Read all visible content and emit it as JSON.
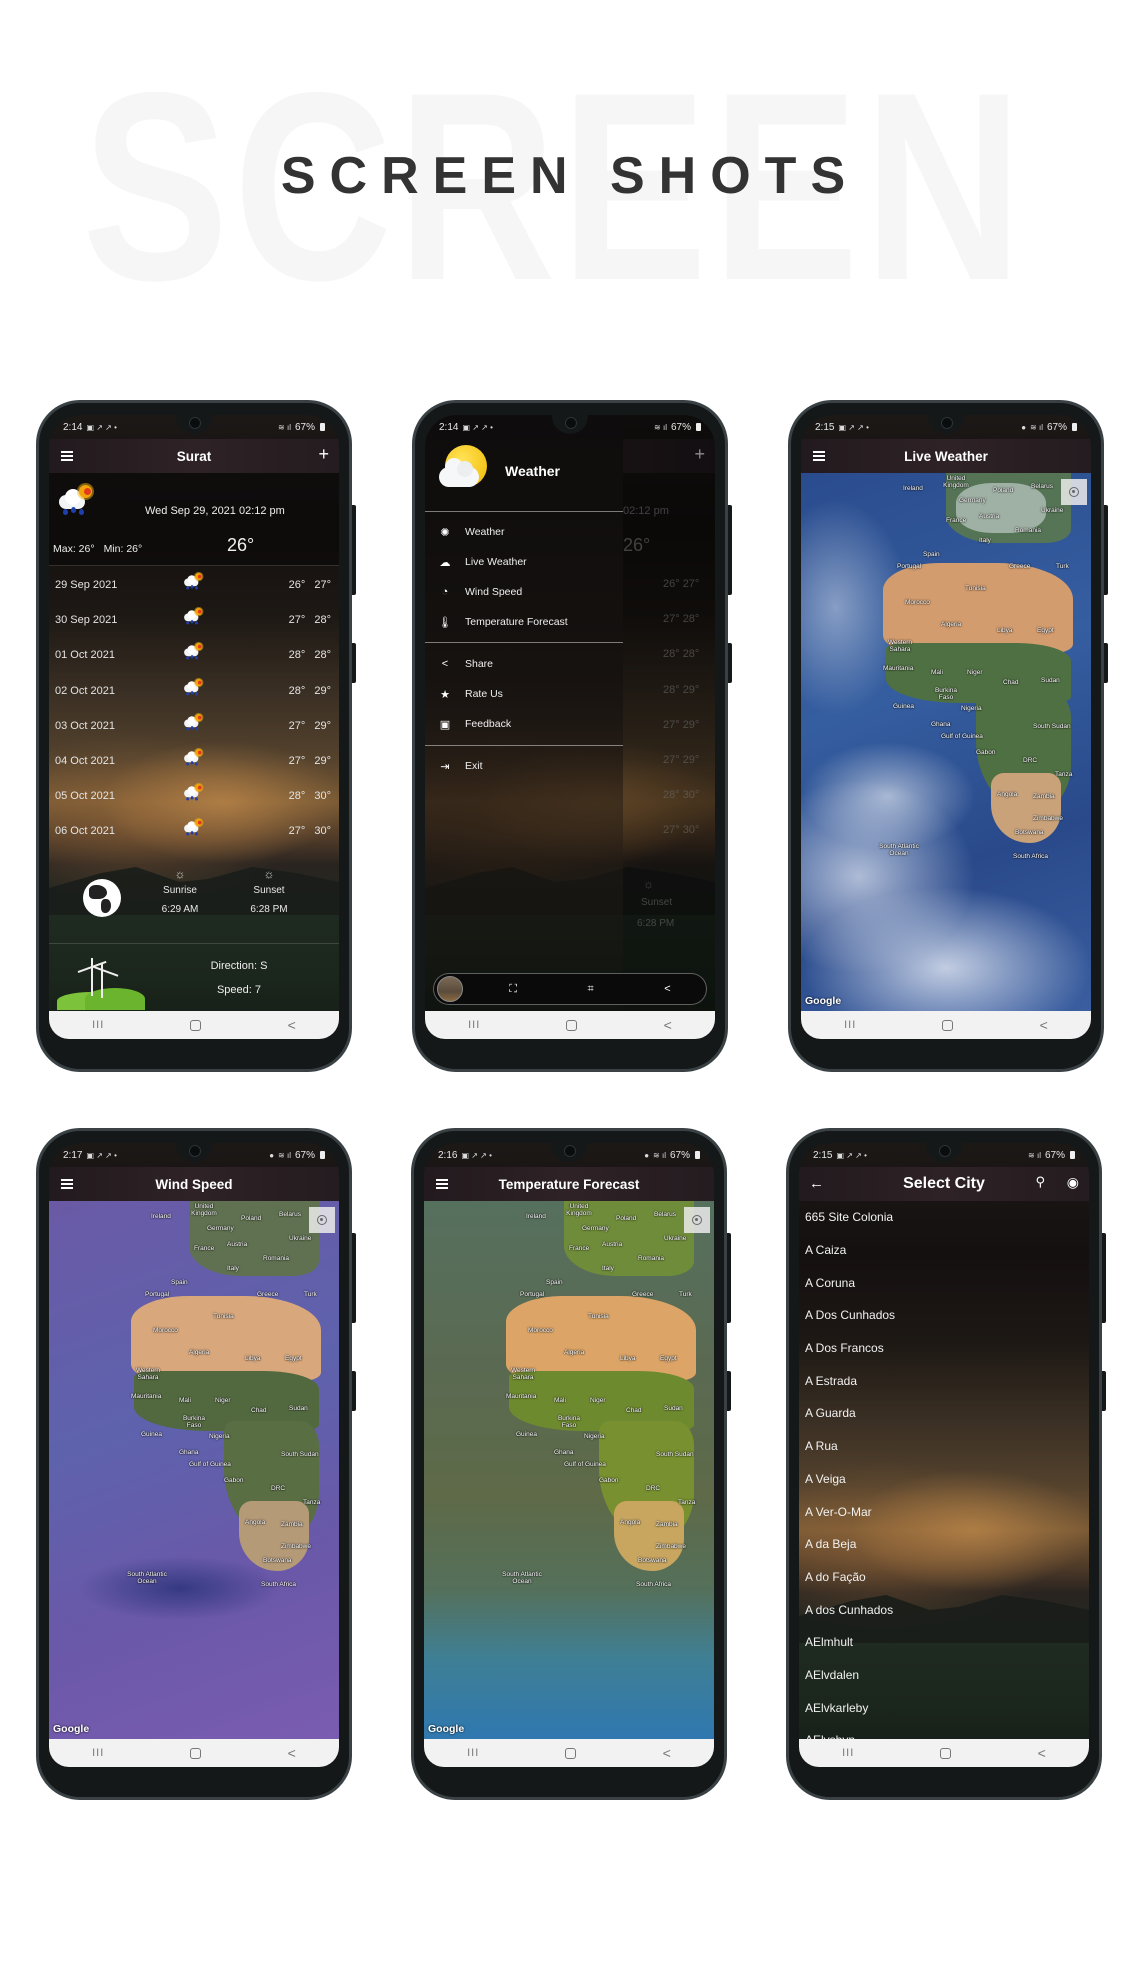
{
  "page": {
    "background_word": "SCREEN",
    "heading": "SCREEN SHOTS"
  },
  "phones": {
    "home": {
      "status": {
        "time": "2:14",
        "battery": "67%"
      },
      "title": "Surat",
      "current": {
        "datetime": "Wed Sep 29, 2021 02:12 pm",
        "max": "Max: 26°",
        "min": "Min: 26°",
        "temp": "26°",
        "condition_icon": "cloud-rain-sun-icon"
      },
      "forecast": [
        {
          "date": "29 Sep 2021",
          "low": "26°",
          "high": "27°"
        },
        {
          "date": "30 Sep 2021",
          "low": "27°",
          "high": "28°"
        },
        {
          "date": "01 Oct 2021",
          "low": "28°",
          "high": "28°"
        },
        {
          "date": "02 Oct 2021",
          "low": "28°",
          "high": "29°"
        },
        {
          "date": "03 Oct 2021",
          "low": "27°",
          "high": "29°"
        },
        {
          "date": "04 Oct 2021",
          "low": "27°",
          "high": "29°"
        },
        {
          "date": "05 Oct 2021",
          "low": "28°",
          "high": "30°"
        },
        {
          "date": "06 Oct 2021",
          "low": "27°",
          "high": "30°"
        }
      ],
      "sunrise": {
        "label": "Sunrise",
        "time": "6:29 AM"
      },
      "sunset": {
        "label": "Sunset",
        "time": "6:28 PM"
      },
      "wind": {
        "direction": "Direction: S",
        "speed": "Speed: 7"
      }
    },
    "drawer": {
      "status": {
        "time": "2:14",
        "battery": "67%"
      },
      "app_name": "Weather",
      "menu_primary": [
        {
          "label": "Weather",
          "icon": "sun-icon"
        },
        {
          "label": "Live Weather",
          "icon": "cloud-icon"
        },
        {
          "label": "Wind Speed",
          "icon": "speedometer-icon"
        },
        {
          "label": "Temperature Forecast",
          "icon": "thermometer-icon"
        }
      ],
      "menu_secondary": [
        {
          "label": "Share",
          "icon": "share-icon"
        },
        {
          "label": "Rate Us",
          "icon": "star-icon"
        },
        {
          "label": "Feedback",
          "icon": "feedback-icon"
        }
      ],
      "menu_exit": {
        "label": "Exit",
        "icon": "exit-icon"
      },
      "behind": {
        "datetime_fragment": "02:12 pm",
        "temp": "26°",
        "temps": [
          "26° 27°",
          "27° 28°",
          "28° 28°",
          "28° 29°",
          "27° 29°",
          "27° 29°",
          "28° 30°",
          "27° 30°"
        ],
        "sunset_label": "Sunset",
        "sunset_time": "6:28 PM"
      }
    },
    "live_weather": {
      "status": {
        "time": "2:15",
        "battery": "67%"
      },
      "title": "Live Weather",
      "map_attribution": "Google"
    },
    "wind_speed": {
      "status": {
        "time": "2:17",
        "battery": "67%"
      },
      "title": "Wind Speed",
      "map_attribution": "Google"
    },
    "temperature_forecast": {
      "status": {
        "time": "2:16",
        "battery": "67%"
      },
      "title": "Temperature Forecast",
      "map_attribution": "Google"
    },
    "select_city": {
      "status": {
        "time": "2:15",
        "battery": "67%"
      },
      "title": "Select City",
      "cities": [
        "665 Site Colonia",
        "A Caiza",
        "A Coruna",
        "A Dos Cunhados",
        "A Dos Francos",
        "A Estrada",
        "A Guarda",
        "A Rua",
        "A Veiga",
        "A Ver-O-Mar",
        "A da Beja",
        "A do Fação",
        "A dos Cunhados",
        "AElmhult",
        "AElvdalen",
        "AElvkarleby",
        "AElvsbyn"
      ]
    }
  },
  "map_labels": [
    "United Kingdom",
    "Ireland",
    "Germany",
    "Poland",
    "Belarus",
    "Ukraine",
    "France",
    "Austria",
    "Romania",
    "Italy",
    "Spain",
    "Portugal",
    "Greece",
    "Turk",
    "Tunisia",
    "Morocco",
    "Algeria",
    "Libya",
    "Egypt",
    "Western Sahara",
    "Mauritania",
    "Mali",
    "Niger",
    "Chad",
    "Sudan",
    "Burkina Faso",
    "Guinea",
    "Nigeria",
    "Ghana",
    "South Sudan",
    "Gulf of Guinea",
    "Gabon",
    "DRC",
    "Tanza",
    "Angola",
    "Zambia",
    "Zimbabwe",
    "Botswana",
    "South Africa",
    "South Atlantic Ocean"
  ],
  "system_nav": {
    "recents": "III",
    "home": "O",
    "back": "<"
  }
}
